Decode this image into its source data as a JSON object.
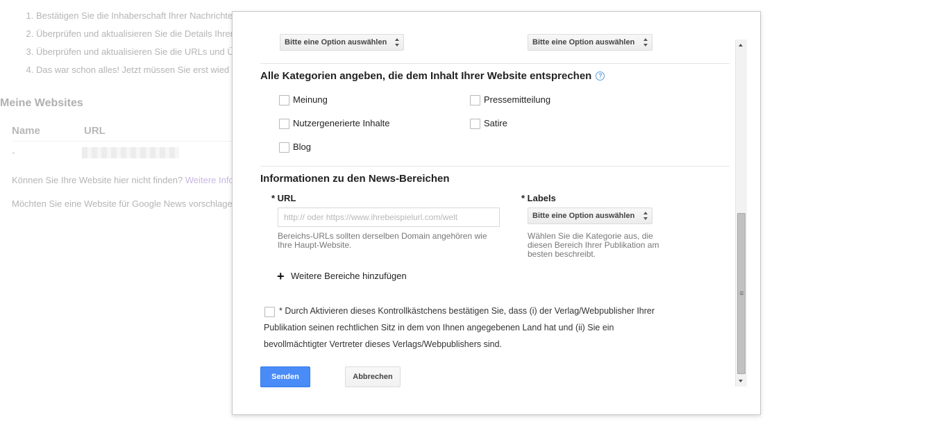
{
  "background": {
    "steps": [
      "Bestätigen Sie die Inhaberschaft Ihrer Nachrichte",
      "Überprüfen und aktualisieren Sie die Details Ihrer",
      "Überprüfen und aktualisieren Sie die URLs und Ü",
      "Das war schon alles! Jetzt müssen Sie erst wied"
    ],
    "heading": "Meine Websites",
    "col_name": "Name",
    "col_url": "URL",
    "row_dash": "-",
    "not_found_text": "Können Sie Ihre Website hier nicht finden?",
    "not_found_link": "Weitere Info",
    "suggest_text": "Möchten Sie eine Website für Google News vorschlage"
  },
  "dialog": {
    "top_select_left": "Bitte eine Option auswählen",
    "top_select_right": "Bitte eine Option auswählen",
    "categories": {
      "heading": "Alle Kategorien angeben, die dem Inhalt Ihrer Website entsprechen",
      "help_icon": "?",
      "options": [
        {
          "label": "Meinung",
          "checked": false
        },
        {
          "label": "Pressemitteilung",
          "checked": false
        },
        {
          "label": "Nutzergenerierte Inhalte",
          "checked": false
        },
        {
          "label": "Satire",
          "checked": false
        },
        {
          "label": "Blog",
          "checked": false
        }
      ]
    },
    "sections": {
      "heading": "Informationen zu den News-Bereichen",
      "url_label": "* URL",
      "url_value": "",
      "url_placeholder": "http:// oder https://www.ihrebeispielurl.com/welt",
      "url_hint": "Bereichs-URLs sollten derselben Domain angehören wie Ihre Haupt-Website.",
      "labels_label": "* Labels",
      "labels_select": "Bitte eine Option auswählen",
      "labels_hint": "Wählen Sie die Kategorie aus, die diesen Bereich Ihrer Publikation am besten beschreibt.",
      "add_icon": "plus-icon",
      "add_label": "Weitere Bereiche hinzufügen"
    },
    "consent": {
      "checked": false,
      "text_line1": "* Durch Aktivieren dieses Kontrollkästchens bestätigen Sie, dass (i) der Verlag/Webpublisher Ihrer",
      "text_line2": "Publikation seinen rechtlichen Sitz in dem von Ihnen angegebenen Land hat und (ii) Sie ein",
      "text_line3": "bevollmächtigter Vertreter dieses Verlags/Webpublishers sind."
    },
    "buttons": {
      "submit": "Senden",
      "cancel": "Abbrechen"
    },
    "colors": {
      "primary_button": "#4a8cf7",
      "help_icon": "#5b9bd5"
    }
  }
}
